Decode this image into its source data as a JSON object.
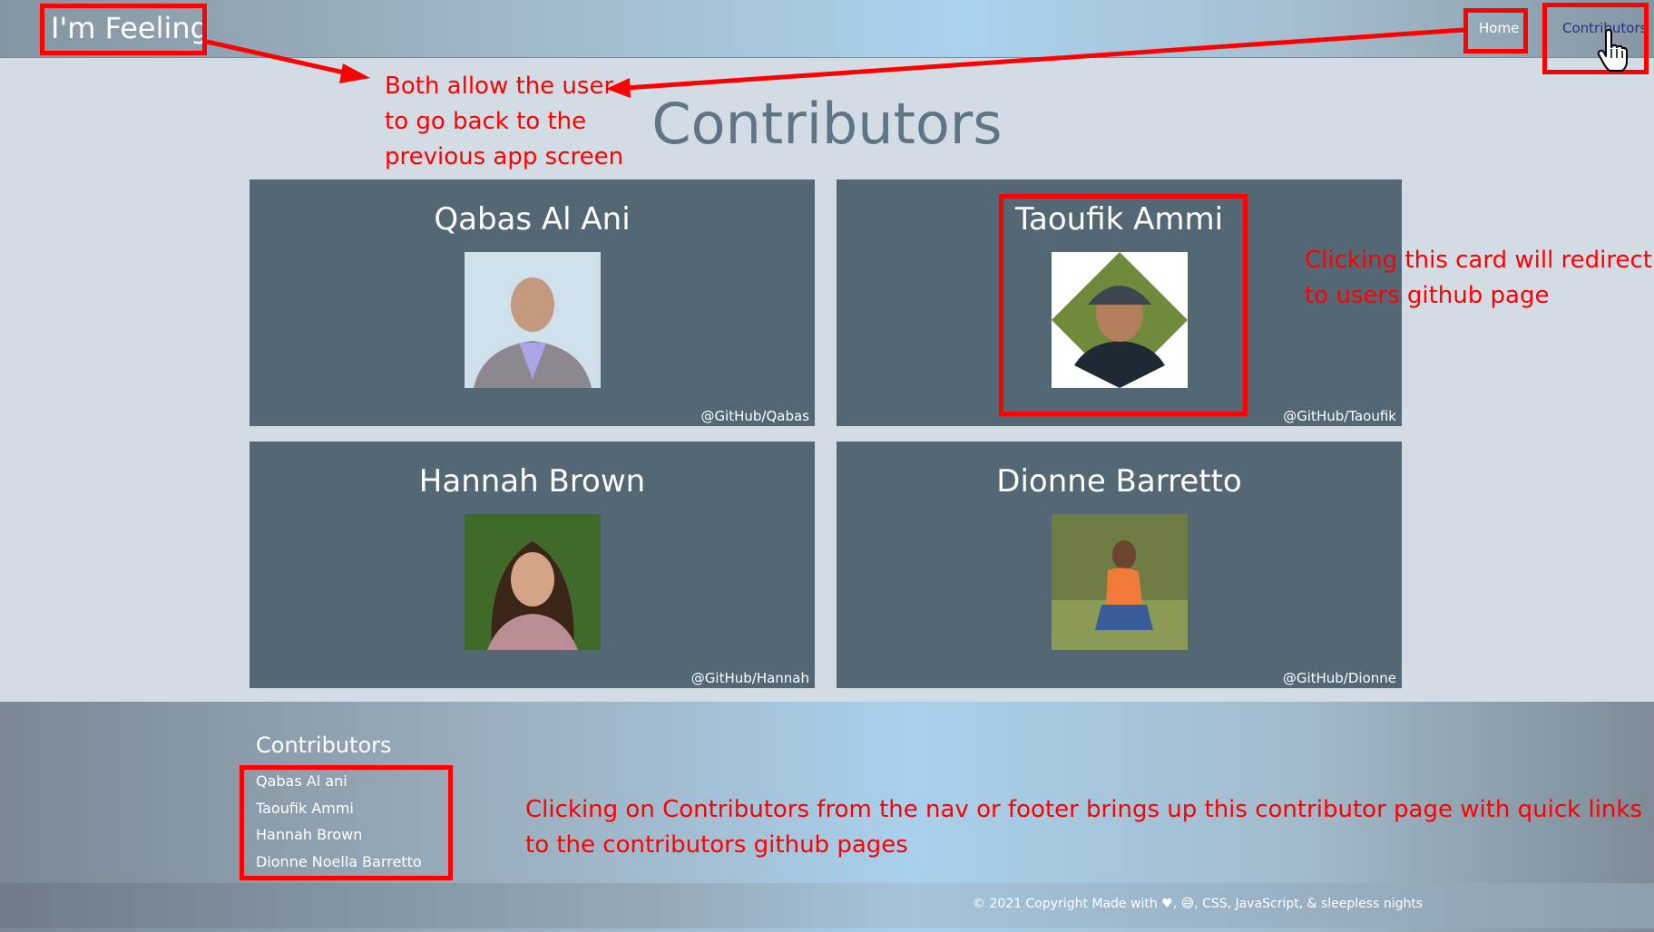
{
  "nav": {
    "brand": "I'm Feeling",
    "home": "Home",
    "contributors": "Contributors"
  },
  "page": {
    "title": "Contributors"
  },
  "cards": [
    {
      "name": "Qabas Al Ani",
      "handle": "@GitHub/Qabas",
      "photo_icon": "person-photo"
    },
    {
      "name": "Taoufik Ammi",
      "handle": "@GitHub/Taoufik",
      "photo_icon": "person-photo"
    },
    {
      "name": "Hannah Brown",
      "handle": "@GitHub/Hannah",
      "photo_icon": "person-photo"
    },
    {
      "name": "Dionne Barretto",
      "handle": "@GitHub/Dionne",
      "photo_icon": "person-photo"
    }
  ],
  "footer": {
    "heading": "Contributors",
    "links": [
      "Qabas Al ani",
      "Taoufik Ammi",
      "Hannah Brown",
      "Dionne Noella Barretto"
    ],
    "copyright": "© 2021 Copyright Made with ♥, 😅, CSS, JavaScript, & sleepless nights"
  },
  "annotations": {
    "back_line1": "Both allow the user",
    "back_line2": "to go back to the",
    "back_line3": "previous app screen",
    "card_line1": "Clicking this card will redirect",
    "card_line2": "to users github page",
    "footer_line1": "Clicking on Contributors from the nav or footer brings up this contributor page with quick links",
    "footer_line2": "to the contributors github pages"
  },
  "colors": {
    "annotation": "#ff0000",
    "card_bg": "#536874",
    "title": "#5e7585",
    "page_bg": "#d3dce4"
  }
}
